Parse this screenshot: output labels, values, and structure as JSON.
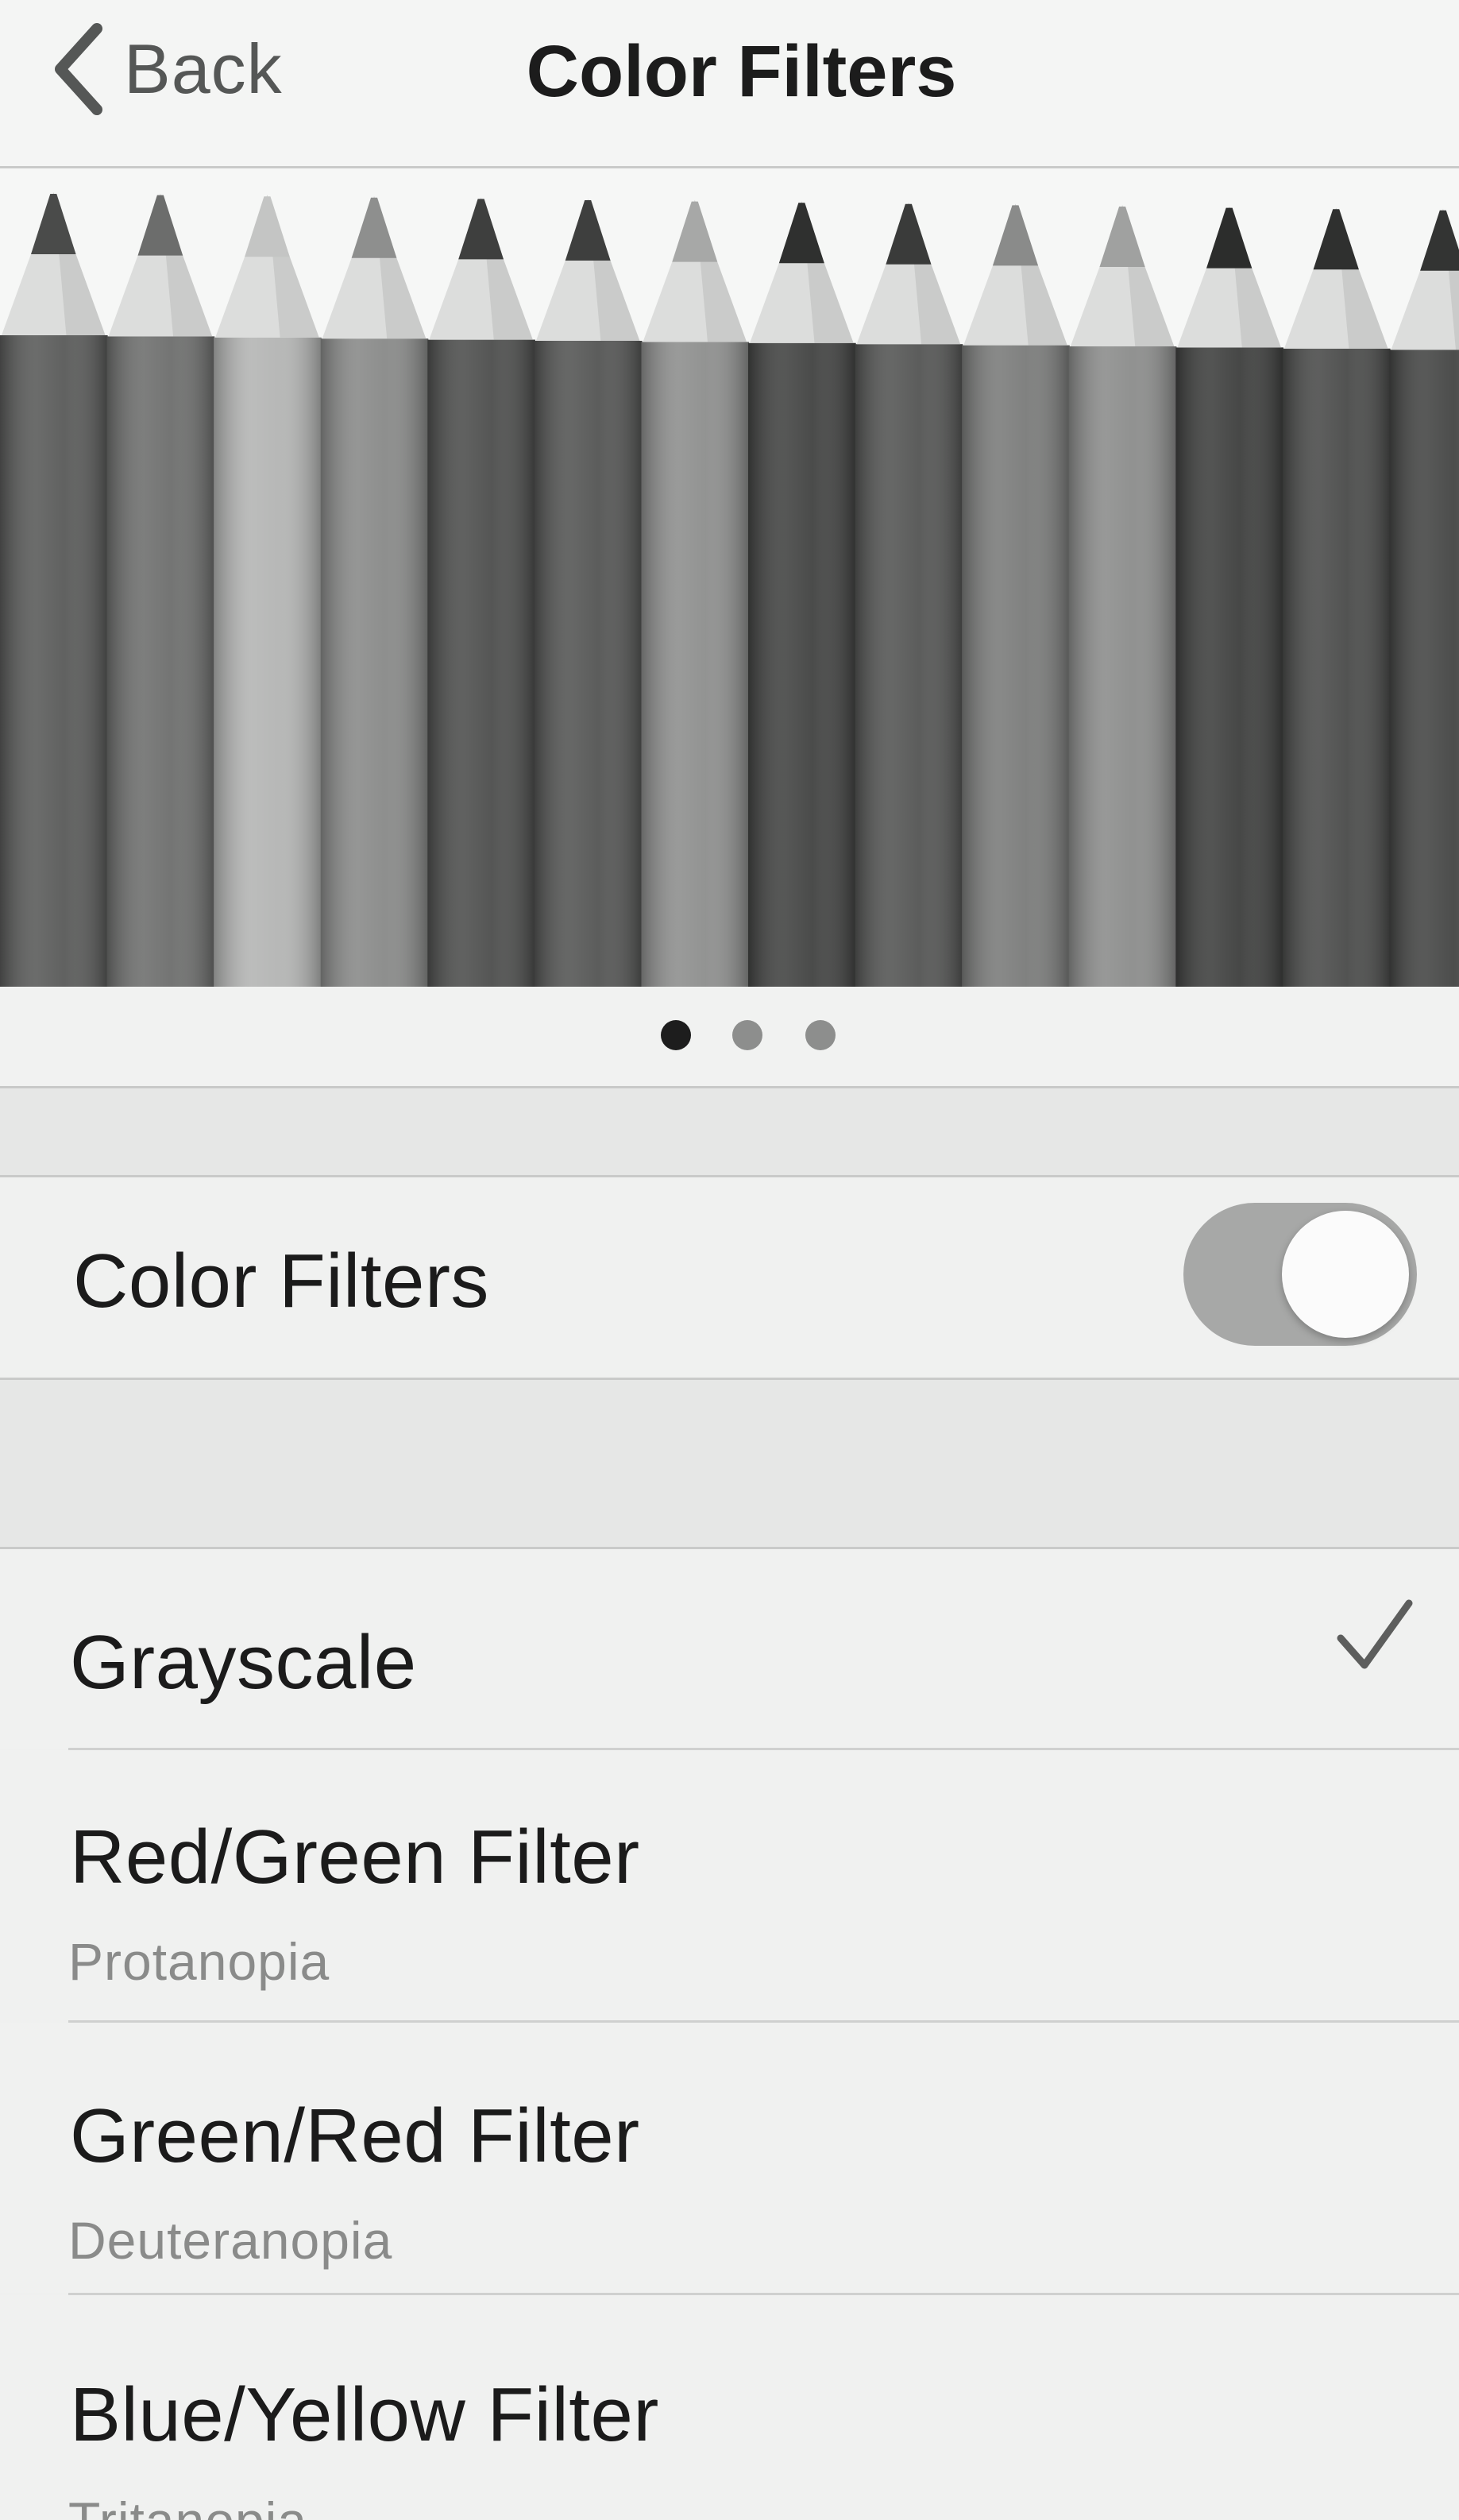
{
  "nav": {
    "back_label": "Back",
    "title": "Color Filters"
  },
  "preview": {
    "pencil_tones": [
      "#5a5b5a",
      "#6e6f6e",
      "#b4b5b4",
      "#898a89",
      "#4e4f4e",
      "#555655",
      "#8e8f8e",
      "#434443",
      "#555655",
      "#7b7c7b",
      "#8c8d8c",
      "#3f403f",
      "#4b4c4b",
      "#454645"
    ],
    "tip_tones": [
      "#4a4b4a",
      "#6c6d6c",
      "#c4c5c4",
      "#8e8f8e",
      "#3e3f3e",
      "#3e3f3e",
      "#a7a8a7",
      "#2f302f",
      "#3a3b3a",
      "#8a8b8a",
      "#a0a1a0",
      "#2c2d2c",
      "#2f302f",
      "#333433"
    ],
    "page_count": 3,
    "active_page": 1
  },
  "toggle_row": {
    "label": "Color Filters",
    "on": true
  },
  "filters": [
    {
      "title": "Grayscale",
      "subtitle": "",
      "selected": true
    },
    {
      "title": "Red/Green Filter",
      "subtitle": "Protanopia",
      "selected": false
    },
    {
      "title": "Green/Red Filter",
      "subtitle": "Deuteranopia",
      "selected": false
    },
    {
      "title": "Blue/Yellow Filter",
      "subtitle": "Tritanopia",
      "selected": false
    }
  ],
  "icons": {
    "back": "chevron-left-icon",
    "checkmark": "checkmark-icon"
  }
}
